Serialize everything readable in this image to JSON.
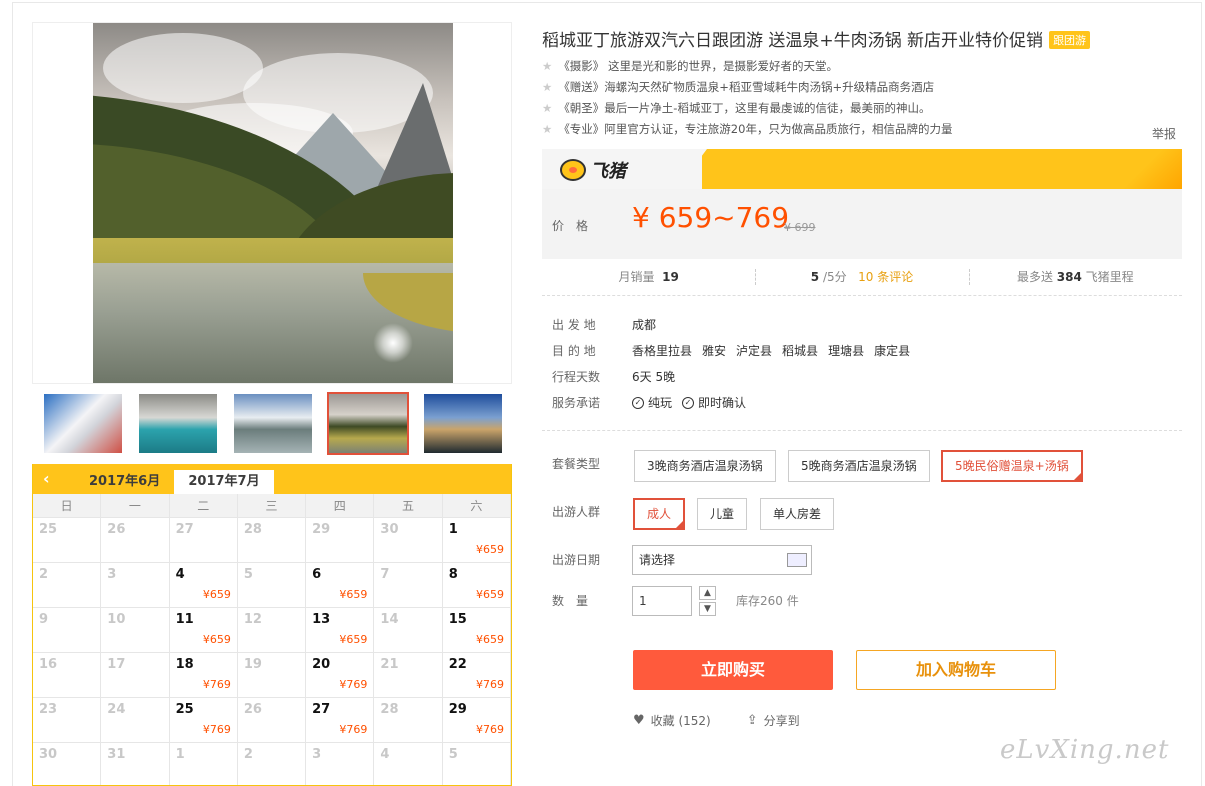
{
  "product": {
    "title": "稻城亚丁旅游双汽六日跟团游 送温泉+牛肉汤锅 新店开业特价促销",
    "tag": "跟团游",
    "features": [
      "《摄影》 这里是光和影的世界，是摄影爱好者的天堂。",
      "《赠送》海螺沟天然矿物质温泉+稻亚雪域耗牛肉汤锅+升级精品商务酒店",
      "《朝圣》最后一片净土-稻城亚丁，这里有最虔诚的信徒，最美丽的神山。",
      "《专业》阿里官方认证，专注旅游20年，只为做高品质旅行，相信品牌的力量"
    ],
    "report": "举报"
  },
  "brand": {
    "name": "飞猪"
  },
  "price": {
    "label": "价格",
    "value": "¥ 659~769",
    "original": "¥ 699"
  },
  "stats": {
    "sales_label": "月销量",
    "sales": "19",
    "rating": "5",
    "rating_suffix": "/5分",
    "reviews": "10 条评论",
    "miles_prefix": "最多送",
    "miles": "384",
    "miles_suffix": "飞猪里程"
  },
  "attrs": {
    "origin_label": "出 发 地",
    "origin": "成都",
    "dest_label": "目 的 地",
    "dests": [
      "香格里拉县",
      "雅安",
      "泸定县",
      "稻城县",
      "理塘县",
      "康定县"
    ],
    "days_label": "行程天数",
    "days": "6天 5晚",
    "promise_label": "服务承诺",
    "promises": [
      "纯玩",
      "即时确认"
    ]
  },
  "options": {
    "package_label": "套餐类型",
    "packages": [
      "3晚商务酒店温泉汤锅",
      "5晚商务酒店温泉汤锅",
      "5晚民俗赠温泉+汤锅"
    ],
    "crowd_label": "出游人群",
    "crowds": [
      "成人",
      "儿童",
      "单人房差"
    ],
    "date_label": "出游日期",
    "date_placeholder": "请选择",
    "qty_label": "数　量",
    "qty": "1",
    "stock": "库存260 件"
  },
  "actions": {
    "buy": "立即购买",
    "cart": "加入购物车",
    "fav": "收藏 (152)",
    "share": "分享到"
  },
  "calendar": {
    "months": [
      "2017年6月",
      "2017年7月"
    ],
    "weekdays": [
      "日",
      "一",
      "二",
      "三",
      "四",
      "五",
      "六"
    ],
    "days": [
      {
        "d": "25"
      },
      {
        "d": "26"
      },
      {
        "d": "27"
      },
      {
        "d": "28"
      },
      {
        "d": "29"
      },
      {
        "d": "30"
      },
      {
        "d": "1",
        "p": "¥659"
      },
      {
        "d": "2"
      },
      {
        "d": "3"
      },
      {
        "d": "4",
        "p": "¥659"
      },
      {
        "d": "5"
      },
      {
        "d": "6",
        "p": "¥659"
      },
      {
        "d": "7"
      },
      {
        "d": "8",
        "p": "¥659"
      },
      {
        "d": "9"
      },
      {
        "d": "10"
      },
      {
        "d": "11",
        "p": "¥659"
      },
      {
        "d": "12"
      },
      {
        "d": "13",
        "p": "¥659"
      },
      {
        "d": "14"
      },
      {
        "d": "15",
        "p": "¥659"
      },
      {
        "d": "16"
      },
      {
        "d": "17"
      },
      {
        "d": "18",
        "p": "¥769"
      },
      {
        "d": "19"
      },
      {
        "d": "20",
        "p": "¥769"
      },
      {
        "d": "21"
      },
      {
        "d": "22",
        "p": "¥769"
      },
      {
        "d": "23"
      },
      {
        "d": "24"
      },
      {
        "d": "25",
        "p": "¥769"
      },
      {
        "d": "26"
      },
      {
        "d": "27",
        "p": "¥769"
      },
      {
        "d": "28"
      },
      {
        "d": "29",
        "p": "¥769"
      },
      {
        "d": "30"
      },
      {
        "d": "31"
      },
      {
        "d": "1"
      },
      {
        "d": "2"
      },
      {
        "d": "3"
      },
      {
        "d": "4"
      },
      {
        "d": "5"
      }
    ]
  },
  "watermark": "eLvXing.net"
}
